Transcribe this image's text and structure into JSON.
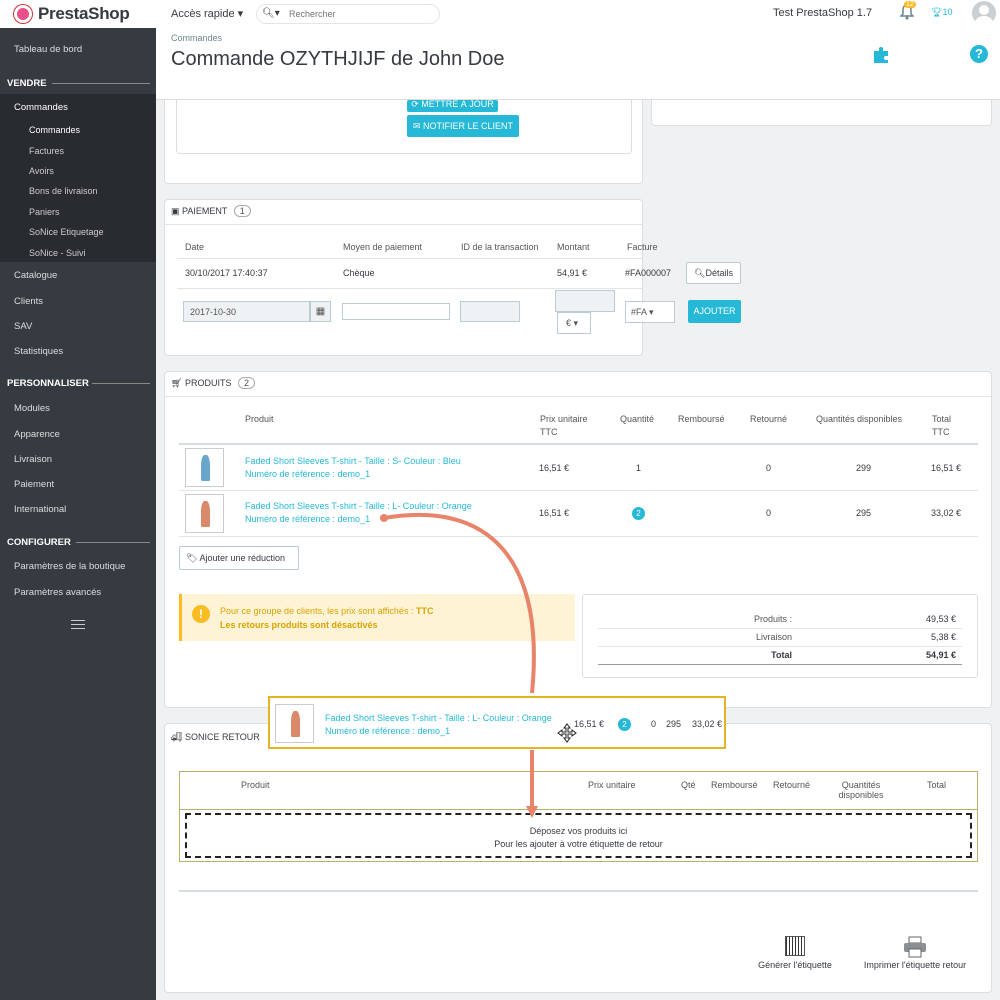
{
  "brand": {
    "name": "PrestaShop",
    "accent": "#25b9d7",
    "sidebar_bg": "#363a41"
  },
  "topbar": {
    "quick_access": "Accès rapide ▾",
    "search_placeholder": "Rechercher",
    "shop_name": "Test PrestaShop 1.7",
    "notif_count": "12",
    "trophy_count": "10"
  },
  "header": {
    "breadcrumb": "Commandes",
    "title": "Commande OZYTHJIJF de John Doe"
  },
  "sidebar": {
    "dashboard": "Tableau de bord",
    "sections": {
      "sell": "VENDRE",
      "customize": "PERSONNALISER",
      "configure": "CONFIGURER"
    },
    "orders": "Commandes",
    "orders_sub": [
      "Commandes",
      "Factures",
      "Avoirs",
      "Bons de livraison",
      "Paniers",
      "SoNice Etiquetage",
      "SoNice - Suivi"
    ],
    "sell_items": [
      "Catalogue",
      "Clients",
      "SAV",
      "Statistiques"
    ],
    "customize_items": [
      "Modules",
      "Apparence",
      "Livraison",
      "Paiement",
      "International"
    ],
    "configure_items": [
      "Paramètres de la boutique",
      "Paramètres avancés"
    ]
  },
  "status_card": {
    "update_button": "METTRE À JOUR",
    "notify_button": "NOTIFIER LE CLIENT"
  },
  "payment": {
    "title": "PAIEMENT",
    "count": "1",
    "headers": [
      "Date",
      "Moyen de paiement",
      "ID de la transaction",
      "Montant",
      "Facture"
    ],
    "row": {
      "date": "30/10/2017 17:40:37",
      "method": "Chèque",
      "transaction": "",
      "amount": "54,91 €",
      "invoice": "#FA000007",
      "details_button": "Détails"
    },
    "form": {
      "date_value": "2017-10-30",
      "currency": "€",
      "invoice": "#FA",
      "add_button": "AJOUTER"
    }
  },
  "products": {
    "title": "PRODUITS",
    "count": "2",
    "headers": {
      "product": "Produit",
      "unit_price": "Prix unitaire",
      "unit_price_sub": "TTC",
      "qty": "Quantité",
      "refunded": "Remboursé",
      "returned": "Retourné",
      "available": "Quantités disponibles",
      "total": "Total",
      "total_sub": "TTC"
    },
    "rows": [
      {
        "name": "Faded Short Sleeves T-shirt - Taille : S- Couleur : Bleu",
        "ref": "Numéro de référence : demo_1",
        "price": "16,51 €",
        "qty": "1",
        "returned": "0",
        "available": "299",
        "total": "16,51 €"
      },
      {
        "name": "Faded Short Sleeves T-shirt - Taille : L- Couleur : Orange",
        "ref": "Numéro de référence : demo_1",
        "price": "16,51 €",
        "qty": "2",
        "returned": "0",
        "available": "295",
        "total": "33,02 €"
      }
    ],
    "add_discount": "Ajouter une réduction",
    "alert_line1": "Pour ce groupe de clients, les prix sont affichés : ",
    "alert_line1_bold": "TTC",
    "alert_line2": "Les retours produits sont désactivés",
    "summary": [
      {
        "label": "Produits :",
        "value": "49,53 €"
      },
      {
        "label": "Livraison",
        "value": "5,38 €"
      },
      {
        "label": "Total",
        "value": "54,91 €"
      }
    ]
  },
  "drag_item": {
    "name": "Faded Short Sleeves T-shirt - Taille : L- Couleur : Orange",
    "ref": "Numéro de référence : demo_1",
    "price": "16,51 €",
    "qty": "2",
    "returned": "0",
    "available": "295",
    "total": "33,02 €"
  },
  "sonice": {
    "title": "SONICE RETOUR",
    "headers": {
      "product": "Produit",
      "unit_price": "Prix unitaire",
      "qty": "Qté",
      "refunded": "Remboursé",
      "returned": "Retourné",
      "available": "Quantités disponibles",
      "total": "Total"
    },
    "drop_line1": "Déposez vos produits ici",
    "drop_line2": "Pour les ajouter à votre étiquette de retour",
    "generate_label": "Générer l'étiquette",
    "print_label": "Imprimer l'étiquette retour"
  }
}
